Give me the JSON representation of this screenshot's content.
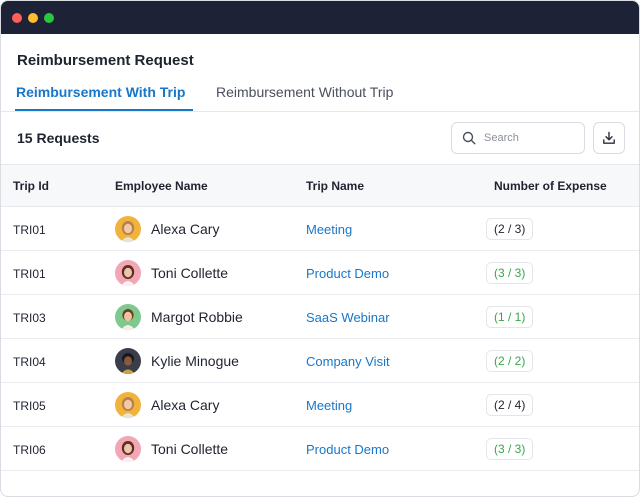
{
  "window": {
    "controls": [
      "close",
      "minimize",
      "maximize"
    ]
  },
  "page": {
    "title": "Reimbursement Request"
  },
  "tabs": [
    {
      "label": "Reimbursement With Trip",
      "active": true
    },
    {
      "label": "Reimbursement Without Trip",
      "active": false
    }
  ],
  "toolbar": {
    "count_label": "15 Requests",
    "search_placeholder": "Search",
    "search_icon": "search-icon",
    "download_icon": "download-icon"
  },
  "table": {
    "headers": [
      "Trip Id",
      "Employee Name",
      "Trip Name",
      "Number of Expense"
    ],
    "rows": [
      {
        "trip_id": "TRI01",
        "employee": "Alexa Cary",
        "trip_name": "Meeting",
        "expense": "(2 / 3)",
        "expense_status": "pending"
      },
      {
        "trip_id": "TRI01",
        "employee": "Toni Collette",
        "trip_name": "Product Demo",
        "expense": "(3 / 3)",
        "expense_status": "complete"
      },
      {
        "trip_id": "TRI03",
        "employee": "Margot Robbie",
        "trip_name": "SaaS Webinar",
        "expense": "(1 / 1)",
        "expense_status": "complete"
      },
      {
        "trip_id": "TRI04",
        "employee": "Kylie Minogue",
        "trip_name": "Company Visit",
        "expense": "(2 / 2)",
        "expense_status": "complete"
      },
      {
        "trip_id": "TRI05",
        "employee": "Alexa Cary",
        "trip_name": "Meeting",
        "expense": "(2 / 4)",
        "expense_status": "pending"
      },
      {
        "trip_id": "TRI06",
        "employee": "Toni Collette",
        "trip_name": "Product Demo",
        "expense": "(3 / 3)",
        "expense_status": "complete"
      }
    ]
  },
  "colors": {
    "accent": "#1877c9",
    "titlebar": "#1d2236",
    "complete": "#3aa64a",
    "pending": "#1f2330"
  }
}
